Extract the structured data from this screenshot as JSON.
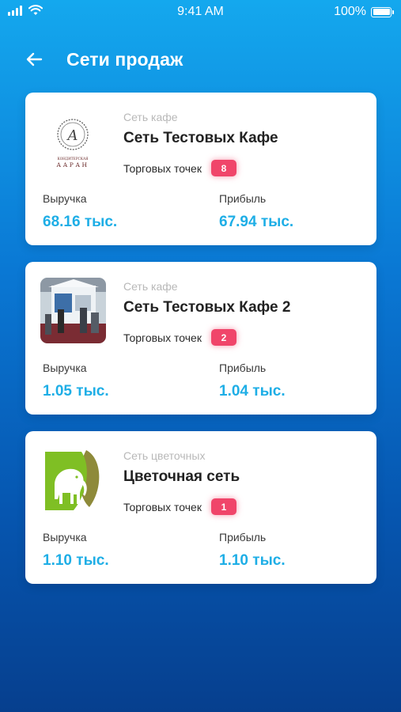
{
  "status_bar": {
    "time": "9:41 AM",
    "battery": "100%",
    "icons": [
      "signal-icon",
      "wifi-icon",
      "battery-icon"
    ]
  },
  "header": {
    "title": "Сети продаж",
    "back_icon": "arrow-left-icon"
  },
  "colors": {
    "background_top": "#14a8ee",
    "background_bottom": "#063f8e",
    "value_accent": "#1eaee6",
    "badge": "#f0456a"
  },
  "networks": [
    {
      "category": "Сеть кафе",
      "name": "Сеть Тестовых Кафе",
      "points_label": "Торговых точек",
      "points_count": "8",
      "revenue_label": "Выручка",
      "revenue_value": "68.16 тыс.",
      "profit_label": "Прибыль",
      "profit_value": "67.94 тыс.",
      "logo_text": "КОНДИТЕРСКАЯ ААРАН",
      "logo_letter": "A"
    },
    {
      "category": "Сеть кафе",
      "name": "Сеть Тестовых Кафе 2",
      "points_label": "Торговых точек",
      "points_count": "2",
      "revenue_label": "Выручка",
      "revenue_value": "1.05 тыс.",
      "profit_label": "Прибыль",
      "profit_value": "1.04 тыс."
    },
    {
      "category": "Сеть цветочных",
      "name": "Цветочная сеть",
      "points_label": "Торговых точек",
      "points_count": "1",
      "revenue_label": "Выручка",
      "revenue_value": "1.10 тыс.",
      "profit_label": "Прибыль",
      "profit_value": "1.10 тыс."
    }
  ]
}
